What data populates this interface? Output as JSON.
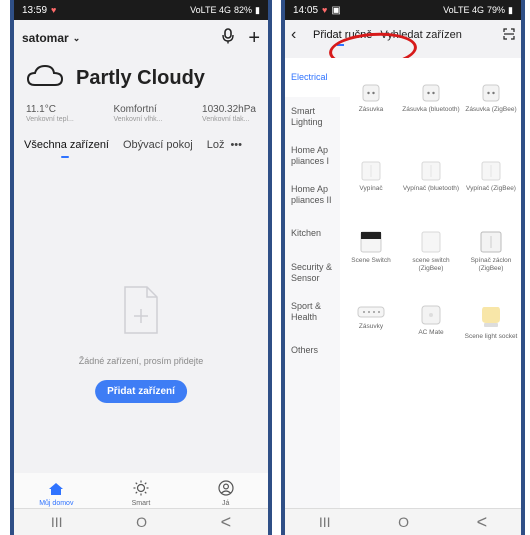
{
  "left": {
    "status": {
      "time": "13:59",
      "signal": "VoLTE 4G",
      "battery": "82%"
    },
    "home_name": "satomar",
    "weather": {
      "title": "Partly Cloudy"
    },
    "metrics": [
      {
        "value": "11.1°C",
        "label": "Venkovní tepl..."
      },
      {
        "value": "Komfortní",
        "label": "Venkovní vlhk..."
      },
      {
        "value": "1030.32hPa",
        "label": "Venkovní tlak..."
      }
    ],
    "tabs": [
      "Všechna zařízení",
      "Obývací pokoj",
      "Lož"
    ],
    "more": "•••",
    "empty_text": "Žádné zařízení, prosím přidejte",
    "add_button": "Přidat zařízení",
    "bottom_tabs": [
      "Můj domov",
      "Smart",
      "Já"
    ]
  },
  "right": {
    "status": {
      "time": "14:05",
      "signal": "VoLTE 4G",
      "battery": "79%"
    },
    "tabs": [
      "Přidat ručně",
      "Vyhledat zařízen"
    ],
    "categories": [
      "Electrical",
      "Smart Lighting",
      "Home Ap pliances I",
      "Home Ap pliances II",
      "Kitchen",
      "Security & Sensor",
      "Sport & Health",
      "Others"
    ],
    "devices": [
      {
        "label": "Zásuvka"
      },
      {
        "label": "Zásuvka (bluetooth)"
      },
      {
        "label": "Zásuvka (ZigBee)"
      },
      {
        "label": "Vypínač"
      },
      {
        "label": "Vypínač (bluetooth)"
      },
      {
        "label": "Vypínač (ZigBee)"
      },
      {
        "label": "Scene Switch"
      },
      {
        "label": "scene switch (ZigBee)"
      },
      {
        "label": "Spínač záclon (ZigBee)"
      },
      {
        "label": "Zásuvky"
      },
      {
        "label": "AC Mate"
      },
      {
        "label": "Scene light socket"
      }
    ]
  },
  "nav": {
    "recent": "III",
    "home": "O",
    "back": "<"
  },
  "colors": {
    "accent": "#2f73ff",
    "phone_frame": "#2f4f86",
    "highlight": "#d71a1a"
  }
}
